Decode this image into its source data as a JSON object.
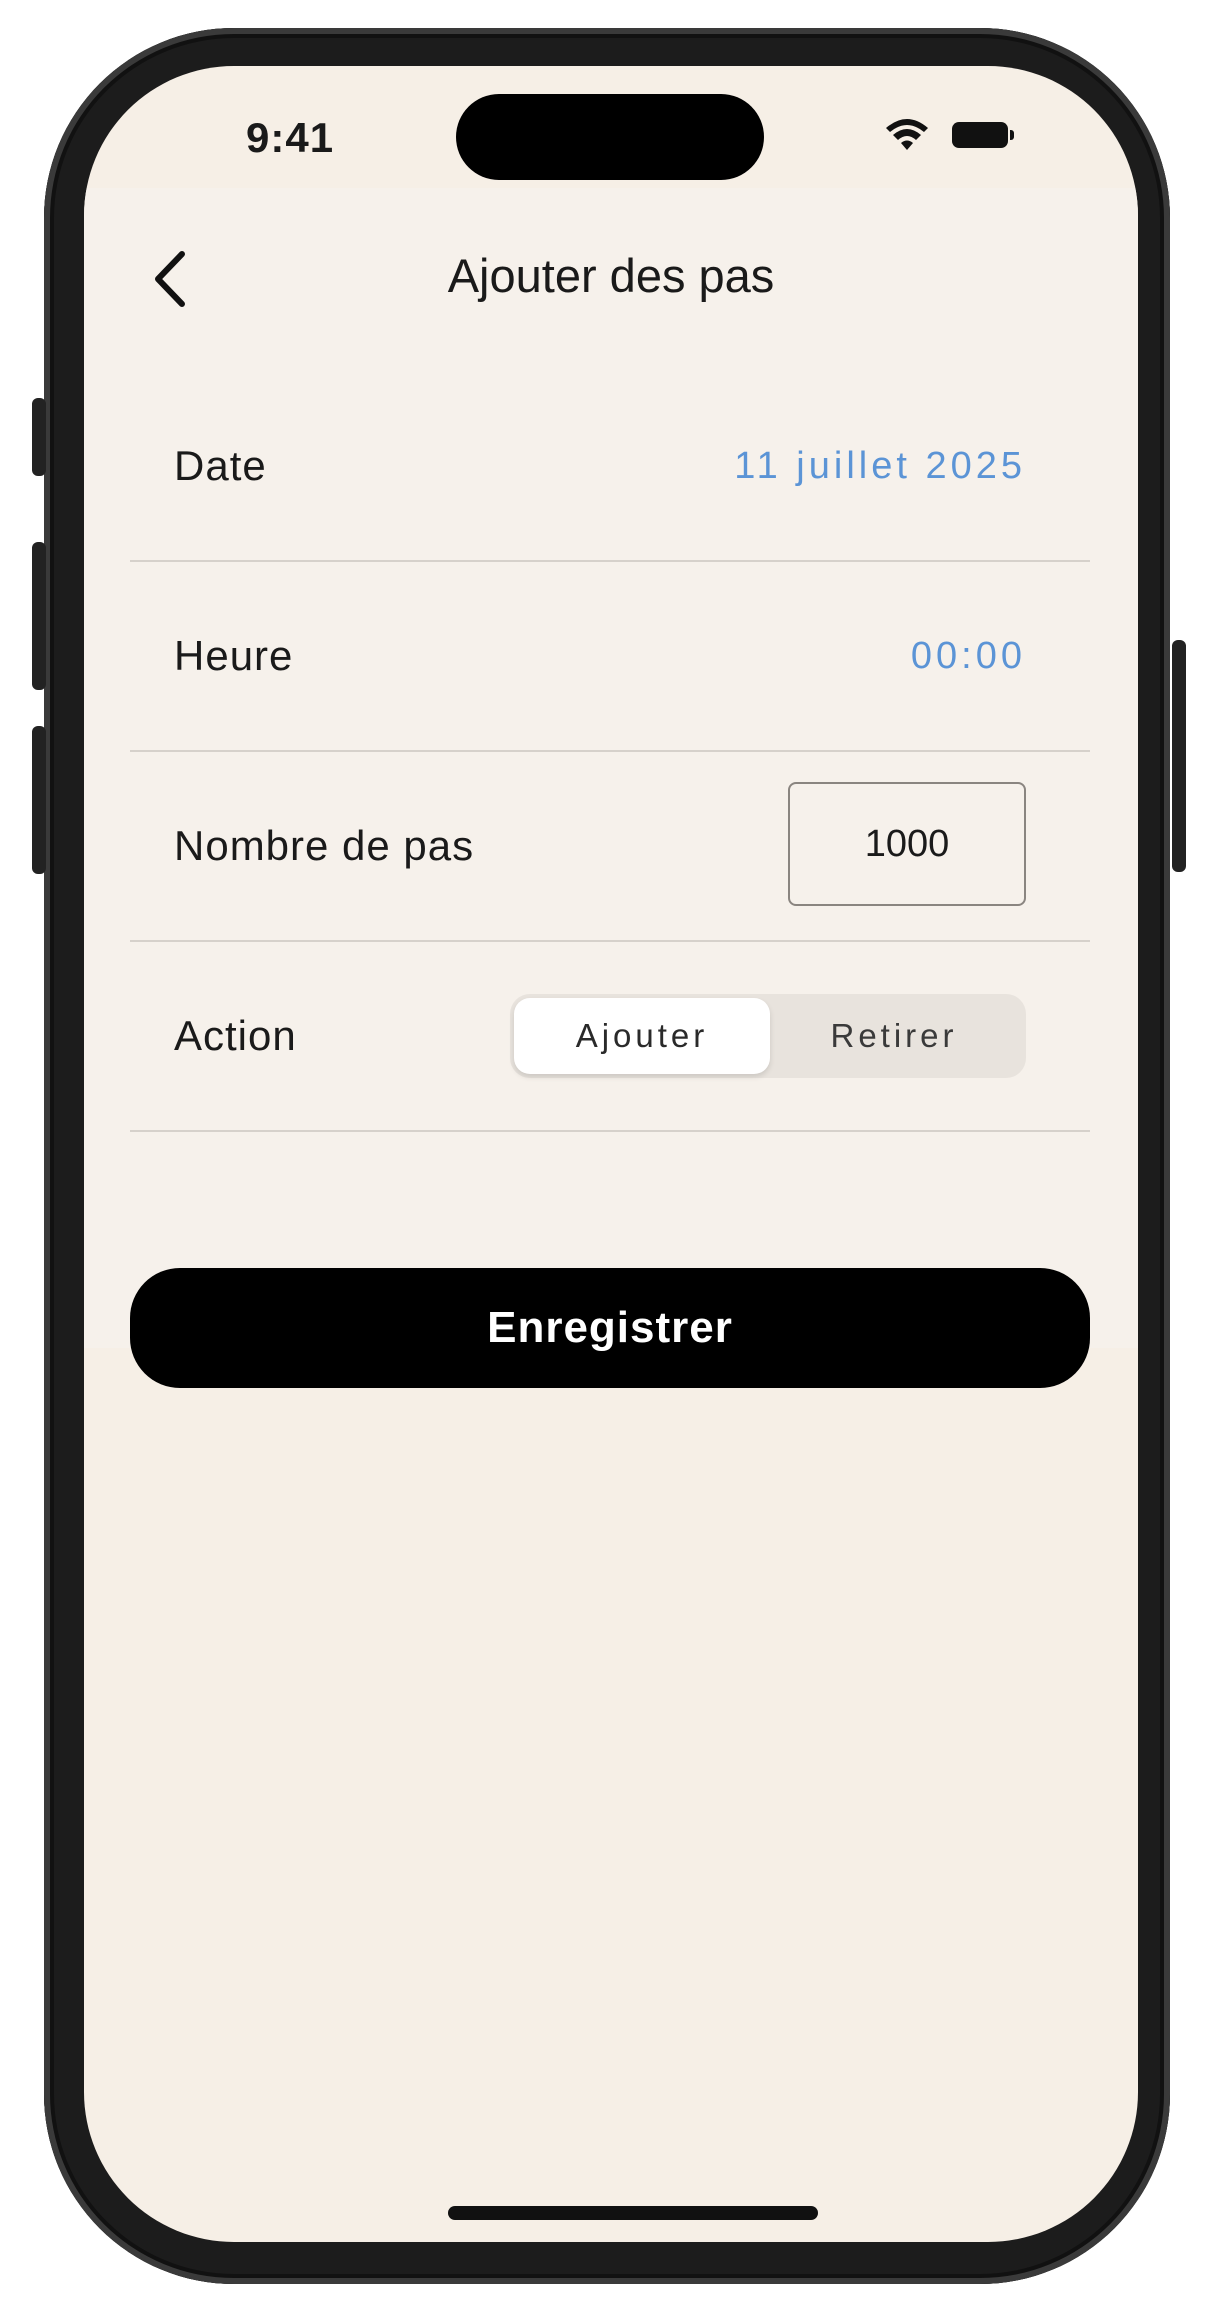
{
  "status_bar": {
    "time": "9:41",
    "wifi_icon": "wifi-icon",
    "battery_icon": "battery-icon"
  },
  "nav": {
    "back_icon": "chevron-left-icon",
    "title": "Ajouter des pas"
  },
  "form": {
    "date": {
      "label": "Date",
      "value": "11 juillet 2025"
    },
    "time": {
      "label": "Heure",
      "value": "00:00"
    },
    "steps": {
      "label": "Nombre de pas",
      "value": "1000"
    },
    "action": {
      "label": "Action",
      "options": [
        "Ajouter",
        "Retirer"
      ],
      "selected": "Ajouter"
    }
  },
  "save_button": {
    "label": "Enregistrer"
  },
  "colors": {
    "background": "#f6efe6",
    "accent": "#5b94d6",
    "button": "#000000"
  }
}
